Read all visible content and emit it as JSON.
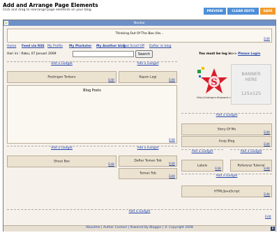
{
  "page": {
    "title": "Add and Arrange Page Elements",
    "subtitle": "Click and drag to rearrange page elements on your blog."
  },
  "toolbar": {
    "preview": "PREVIEW",
    "clear": "CLEAR EDITS",
    "save": "SAVE"
  },
  "navbar": {
    "label": "Navbar"
  },
  "header": {
    "title": "Thinking Out Of The Box (He...",
    "edit": "Edit"
  },
  "nav_links": [
    "Home",
    "Feed via RSS",
    "My Profile",
    "My Plurkster",
    "My Another blog",
    "Text Scroll Off",
    "Daftar isi blog"
  ],
  "date_info": "Hari ini : Rabu, 07 Januari 2009",
  "search": {
    "placeholder": "",
    "button": "Search"
  },
  "login": {
    "question": "You must be log in>>",
    "link": "Please Login"
  },
  "common": {
    "add": "Add a Gadget",
    "edit": "Edit"
  },
  "gadgets": {
    "postingan": "Postingan Terbaru",
    "kapan": "Kapan Lagi",
    "blogposts": "Blog Posts",
    "shout": "Shout Box",
    "daftar": "Daftar Teman Tob",
    "teman": "Teman Tob",
    "story": "Story Of Me",
    "arsip": "Arsip Blog",
    "labels": "Labels",
    "referensi": "Referensi Tutorial",
    "html": "HTML/JavaScript"
  },
  "logo": {
    "caption": "http://subagus.blogspot.com",
    "letter": "S"
  },
  "banner": {
    "line1": "BANNER",
    "line2": "HERE",
    "line3": "125x125"
  },
  "footer": {
    "text": "Aboutme | Author Contact | Powered By Blogger | © Copyright 2008"
  },
  "colors": {
    "navbar": "#6d90c6",
    "preview": "#4f8fd8",
    "save": "#f39a2a",
    "gadget": "#ece2d0"
  }
}
